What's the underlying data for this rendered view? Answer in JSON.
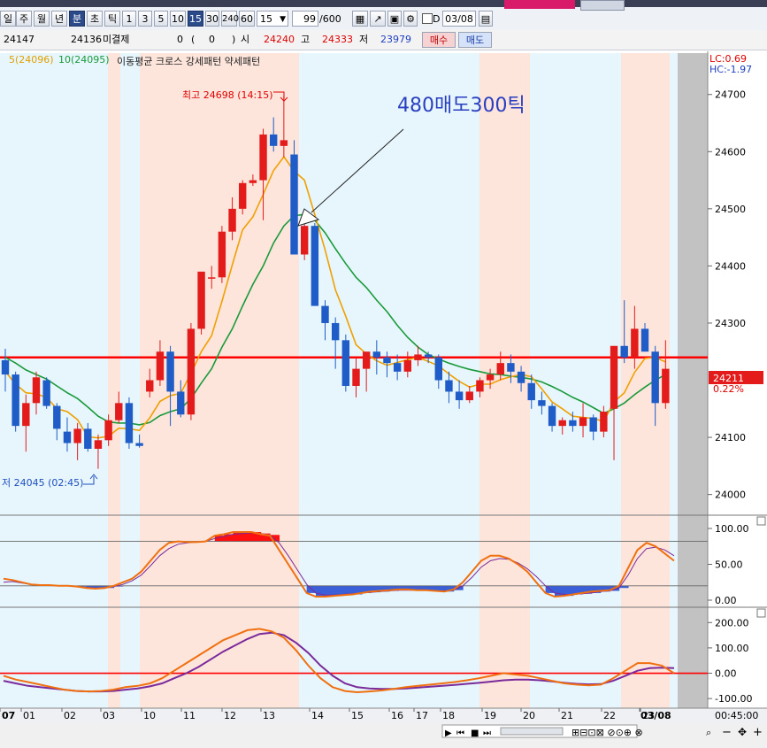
{
  "toolbar": {
    "period_buttons": [
      "일",
      "주",
      "월",
      "년",
      "분",
      "초",
      "틱"
    ],
    "interval_buttons": [
      "1",
      "3",
      "5",
      "10",
      "15",
      "30",
      "240",
      "60"
    ],
    "interval_select": "15",
    "count_value": "99",
    "count_total": "/600",
    "date_value": "03/08",
    "checkbox_label": "D"
  },
  "quote": {
    "current": "24147",
    "prev": "24136",
    "label_open_interest": "미결제",
    "oi_value": "0",
    "oi_change": "0",
    "label_open": "시",
    "open": "24240",
    "label_high": "고",
    "high": "24333",
    "label_low": "저",
    "low": "23979",
    "buy_label": "매수",
    "sell_label": "매도"
  },
  "legend": {
    "ma5": "5(24096)",
    "ma10": "10(24095)",
    "text": "이동평균 크로스 강세패턴  약세패턴"
  },
  "lc": "LC:0.69",
  "hc": "HC:-1.97",
  "annotations": {
    "high": "최고 24698 (14:15)",
    "low": "저 24045 (02:45)",
    "note": "480매도300틱"
  },
  "price_tag": "24211",
  "change_tag": "0.22%",
  "price_axis": [
    "24700",
    "24600",
    "24500",
    "24400",
    "24300",
    "24100",
    "24000"
  ],
  "osc1_axis": [
    "100.00",
    "50.00",
    "0.00"
  ],
  "osc2_axis": [
    "200.00",
    "100.00",
    "0.00",
    "-100.00"
  ],
  "time_labels": [
    "07",
    "01",
    "02",
    "03",
    "10",
    "11",
    "12",
    "13",
    "14",
    "15",
    "16",
    "17",
    "18",
    "19",
    "20",
    "21",
    "22",
    "23",
    "03/08"
  ],
  "time_readout": "00:45:00",
  "colors": {
    "up": "#e31b1b",
    "down": "#1f5cc8",
    "ma5": "#f0a000",
    "ma10": "#1a9a3a",
    "hline": "#ff0000"
  },
  "chart_data": [
    {
      "type": "candlestick",
      "candles": [
        [
          24235,
          24255,
          24180,
          24210
        ],
        [
          24210,
          24215,
          24110,
          24120
        ],
        [
          24120,
          24175,
          24075,
          24160
        ],
        [
          24160,
          24215,
          24140,
          24205
        ],
        [
          24200,
          24205,
          24150,
          24155
        ],
        [
          24155,
          24160,
          24095,
          24115
        ],
        [
          24110,
          24135,
          24075,
          24090
        ],
        [
          24090,
          24125,
          24060,
          24115
        ],
        [
          24115,
          24125,
          24075,
          24080
        ],
        [
          24080,
          24105,
          24045,
          24095
        ],
        [
          24095,
          24140,
          24085,
          24130
        ],
        [
          24130,
          24180,
          24125,
          24160
        ],
        [
          24160,
          24170,
          24080,
          24090
        ],
        [
          24090,
          24105,
          24082,
          24085
        ],
        [
          24180,
          24220,
          24170,
          24200
        ],
        [
          24200,
          24270,
          24190,
          24250
        ],
        [
          24250,
          24260,
          24120,
          24180
        ],
        [
          24180,
          24200,
          24135,
          24140
        ],
        [
          24140,
          24300,
          24130,
          24290
        ],
        [
          24290,
          24380,
          24280,
          24390
        ],
        [
          24380,
          24400,
          24360,
          24380
        ],
        [
          24380,
          24470,
          24370,
          24460
        ],
        [
          24460,
          24520,
          24445,
          24500
        ],
        [
          24500,
          24550,
          24490,
          24545
        ],
        [
          24545,
          24560,
          24540,
          24550
        ],
        [
          24550,
          24640,
          24480,
          24630
        ],
        [
          24630,
          24660,
          24600,
          24610
        ],
        [
          24610,
          24698,
          24590,
          24620
        ],
        [
          24595,
          24620,
          24450,
          24420
        ],
        [
          24420,
          24480,
          24410,
          24470
        ],
        [
          24470,
          24475,
          24330,
          24330
        ],
        [
          24330,
          24340,
          24270,
          24300
        ],
        [
          24300,
          24310,
          24220,
          24270
        ],
        [
          24270,
          24280,
          24180,
          24190
        ],
        [
          24190,
          24240,
          24170,
          24220
        ],
        [
          24220,
          24240,
          24180,
          24250
        ],
        [
          24250,
          24270,
          24210,
          24240
        ],
        [
          24240,
          24250,
          24205,
          24230
        ],
        [
          24230,
          24245,
          24200,
          24215
        ],
        [
          24215,
          24250,
          24205,
          24235
        ],
        [
          24235,
          24260,
          24225,
          24245
        ],
        [
          24245,
          24250,
          24230,
          24240
        ],
        [
          24240,
          24245,
          24185,
          24200
        ],
        [
          24200,
          24215,
          24160,
          24180
        ],
        [
          24180,
          24200,
          24150,
          24165
        ],
        [
          24165,
          24190,
          24160,
          24180
        ],
        [
          24180,
          24205,
          24170,
          24200
        ],
        [
          24200,
          24220,
          24185,
          24210
        ],
        [
          24210,
          24250,
          24200,
          24230
        ],
        [
          24230,
          24245,
          24195,
          24215
        ],
        [
          24215,
          24225,
          24180,
          24195
        ],
        [
          24195,
          24210,
          24150,
          24165
        ],
        [
          24165,
          24180,
          24140,
          24155
        ],
        [
          24155,
          24160,
          24110,
          24120
        ],
        [
          24120,
          24135,
          24105,
          24130
        ],
        [
          24130,
          24145,
          24110,
          24120
        ],
        [
          24120,
          24160,
          24100,
          24135
        ],
        [
          24135,
          24140,
          24095,
          24110
        ],
        [
          24110,
          24155,
          24100,
          24145
        ],
        [
          24150,
          24260,
          24060,
          24260
        ],
        [
          24260,
          24340,
          24230,
          24240
        ],
        [
          24240,
          24330,
          24220,
          24290
        ],
        [
          24290,
          24300,
          24250,
          24250
        ],
        [
          24250,
          24260,
          24120,
          24160
        ],
        [
          24160,
          24270,
          24150,
          24220
        ]
      ],
      "ma5": [
        24215,
        24193,
        24178,
        24176,
        24170,
        24150,
        24145,
        24131,
        24101,
        24099,
        24102,
        24116,
        24115,
        24112,
        24134,
        24163,
        24173,
        24177,
        24212,
        24250,
        24278,
        24338,
        24402,
        24463,
        24486,
        24525,
        24567,
        24591,
        24566,
        24550,
        24490,
        24428,
        24358,
        24312,
        24262,
        24246,
        24234,
        24226,
        24231,
        24236,
        24240,
        24233,
        24225,
        24211,
        24198,
        24188,
        24193,
        24193,
        24201,
        24206,
        24210,
        24206,
        24185,
        24162,
        24150,
        24137,
        24135,
        24133,
        24128,
        24162,
        24178,
        24214,
        24238,
        24240,
        24232
      ],
      "ma10": [
        24240,
        24230,
        24218,
        24210,
        24202,
        24190,
        24178,
        24168,
        24153,
        24137,
        24127,
        24125,
        24125,
        24122,
        24126,
        24138,
        24145,
        24150,
        24168,
        24195,
        24220,
        24258,
        24290,
        24330,
        24368,
        24400,
        24440,
        24470,
        24488,
        24490,
        24480,
        24458,
        24430,
        24404,
        24380,
        24362,
        24340,
        24320,
        24296,
        24275,
        24258,
        24245,
        24237,
        24230,
        24224,
        24219,
        24215,
        24211,
        24210,
        24207,
        24205,
        24202,
        24197,
        24189,
        24180,
        24170,
        24162,
        24152,
        24142,
        24150,
        24160,
        24175,
        24188,
        24200,
        24210
      ],
      "price_lines": [
        24240
      ],
      "ylim": [
        23970,
        24760
      ]
    },
    {
      "type": "line",
      "series": [
        {
          "values": [
            30,
            28,
            25,
            22,
            21,
            21,
            20,
            20,
            19,
            17,
            16,
            17,
            20,
            25,
            30,
            40,
            55,
            70,
            80,
            82,
            81,
            81,
            82,
            90,
            92,
            95,
            95,
            95,
            92,
            90,
            70,
            50,
            30,
            10,
            5,
            5,
            6,
            7,
            8,
            10,
            12,
            13,
            14,
            15,
            15,
            14,
            14,
            13,
            12,
            15,
            25,
            40,
            55,
            62,
            62,
            58,
            50,
            40,
            25,
            10,
            5,
            6,
            8,
            10,
            12,
            13,
            14,
            20,
            45,
            70,
            80,
            75,
            65,
            55
          ]
        },
        {
          "values": [
            25,
            26,
            24,
            22,
            21,
            21,
            20,
            20,
            19,
            18,
            17,
            17,
            19,
            22,
            27,
            35,
            48,
            62,
            72,
            78,
            80,
            81,
            82,
            86,
            89,
            92,
            93,
            94,
            93,
            91,
            80,
            62,
            42,
            22,
            10,
            7,
            7,
            8,
            9,
            10,
            11,
            12,
            13,
            14,
            14,
            14,
            14,
            13,
            13,
            14,
            20,
            32,
            46,
            55,
            58,
            57,
            52,
            44,
            33,
            20,
            10,
            8,
            8,
            9,
            10,
            12,
            13,
            17,
            35,
            58,
            72,
            74,
            70,
            62
          ]
        }
      ],
      "ylim": [
        0,
        100
      ],
      "price_lines": [
        20,
        82
      ]
    },
    {
      "type": "line",
      "series": [
        {
          "values": [
            -10,
            -25,
            -35,
            -45,
            -55,
            -65,
            -70,
            -72,
            -70,
            -65,
            -55,
            -50,
            -40,
            -20,
            10,
            40,
            70,
            100,
            130,
            150,
            170,
            175,
            165,
            140,
            90,
            30,
            -20,
            -55,
            -70,
            -75,
            -72,
            -68,
            -62,
            -55,
            -50,
            -45,
            -40,
            -35,
            -28,
            -20,
            -10,
            0,
            -5,
            -10,
            -20,
            -30,
            -40,
            -45,
            -48,
            -45,
            -20,
            10,
            40,
            40,
            30,
            0
          ]
        },
        {
          "values": [
            -30,
            -40,
            -50,
            -55,
            -60,
            -65,
            -70,
            -72,
            -72,
            -70,
            -65,
            -60,
            -52,
            -40,
            -20,
            0,
            25,
            55,
            85,
            110,
            135,
            155,
            160,
            150,
            120,
            80,
            30,
            -10,
            -40,
            -55,
            -60,
            -62,
            -62,
            -60,
            -57,
            -53,
            -50,
            -46,
            -42,
            -38,
            -33,
            -28,
            -25,
            -25,
            -28,
            -32,
            -38,
            -42,
            -44,
            -43,
            -30,
            -10,
            10,
            20,
            22,
            20
          ]
        }
      ],
      "ylim": [
        -110,
        215
      ],
      "price_lines": [
        0
      ]
    }
  ]
}
